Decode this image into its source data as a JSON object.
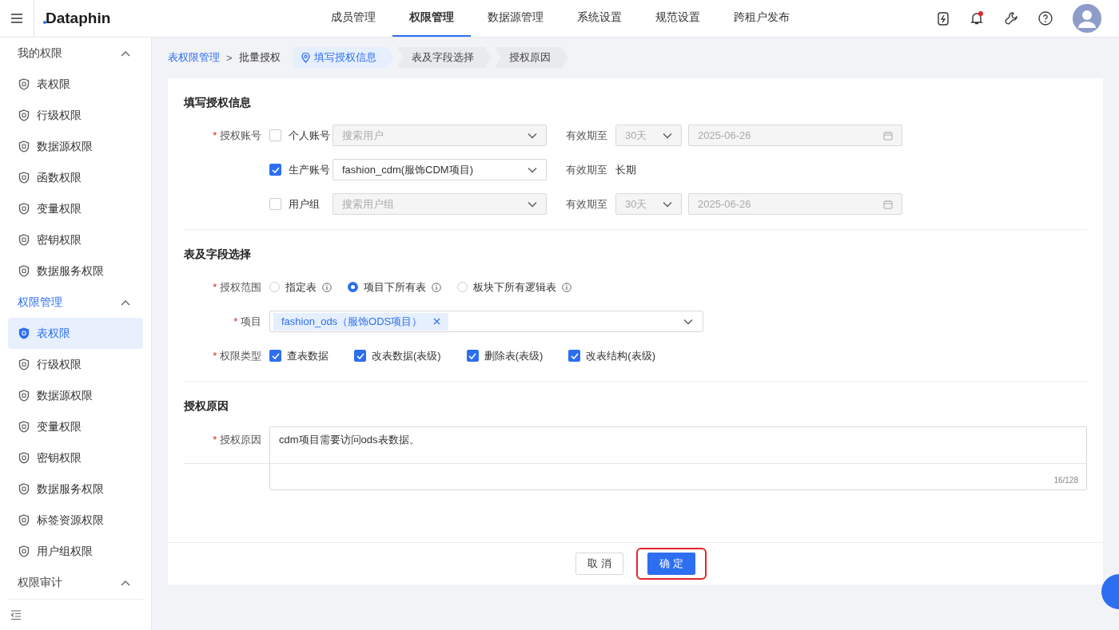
{
  "header": {
    "logo": "Dataphin",
    "nav": [
      {
        "label": "成员管理",
        "selected": false
      },
      {
        "label": "权限管理",
        "selected": true
      },
      {
        "label": "数据源管理",
        "selected": false
      },
      {
        "label": "系统设置",
        "selected": false
      },
      {
        "label": "规范设置",
        "selected": false
      },
      {
        "label": "跨租户发布",
        "selected": false
      }
    ],
    "unread_notifications": true
  },
  "sidebar": {
    "groups": [
      {
        "title": "我的权限",
        "selected": false,
        "expanded": true,
        "items": [
          {
            "label": "表权限",
            "selected": false
          },
          {
            "label": "行级权限",
            "selected": false
          },
          {
            "label": "数据源权限",
            "selected": false
          },
          {
            "label": "函数权限",
            "selected": false
          },
          {
            "label": "变量权限",
            "selected": false
          },
          {
            "label": "密钥权限",
            "selected": false
          },
          {
            "label": "数据服务权限",
            "selected": false
          }
        ]
      },
      {
        "title": "权限管理",
        "selected": true,
        "expanded": true,
        "items": [
          {
            "label": "表权限",
            "selected": true
          },
          {
            "label": "行级权限",
            "selected": false
          },
          {
            "label": "数据源权限",
            "selected": false
          },
          {
            "label": "变量权限",
            "selected": false
          },
          {
            "label": "密钥权限",
            "selected": false
          },
          {
            "label": "数据服务权限",
            "selected": false
          },
          {
            "label": "标签资源权限",
            "selected": false
          },
          {
            "label": "用户组权限",
            "selected": false
          }
        ]
      },
      {
        "title": "权限审计",
        "selected": false,
        "expanded": true
      }
    ]
  },
  "breadcrumb": [
    {
      "label": "表权限管理",
      "kind": "link"
    },
    {
      "separator": ">",
      "label": "批量授权",
      "kind": "text"
    }
  ],
  "steps": [
    {
      "label": "填写授权信息",
      "selected": true
    },
    {
      "label": "表及字段选择",
      "selected": false
    },
    {
      "label": "授权原因",
      "selected": false
    }
  ],
  "account_section": {
    "title": "填写授权信息",
    "required_mark": "*",
    "label": "授权账号",
    "rows": [
      {
        "label": "个人账号",
        "checked": false,
        "placeholder": "搜索用户",
        "expiry_label": "有效期至",
        "duration": "30天",
        "date": "2025-06-26"
      },
      {
        "label": "生产账号",
        "checked": true,
        "value": "fashion_cdm(服饰CDM项目)",
        "expiry_label": "有效期至",
        "expiry": "长期"
      },
      {
        "label": "用户组",
        "checked": false,
        "placeholder": "搜索用户组",
        "expiry_label": "有效期至",
        "duration": "30天",
        "date": "2025-06-26"
      }
    ]
  },
  "table_section": {
    "title": "表及字段选择",
    "scope": {
      "required_mark": "*",
      "label": "授权范围",
      "options": [
        {
          "label": "指定表",
          "selected": false
        },
        {
          "label": "项目下所有表",
          "selected": true
        },
        {
          "label": "板块下所有逻辑表",
          "selected": false
        }
      ]
    },
    "project": {
      "required_mark": "*",
      "label": "项目",
      "tags": [
        "fashion_ods（服饰ODS项目）"
      ]
    },
    "types": {
      "required_mark": "*",
      "label": "权限类型",
      "options": [
        {
          "label": "查表数据",
          "checked": true
        },
        {
          "label": "改表数据(表级)",
          "checked": true
        },
        {
          "label": "删除表(表级)",
          "checked": true
        },
        {
          "label": "改表结构(表级)",
          "checked": true
        }
      ]
    }
  },
  "reason_section": {
    "title": "授权原因",
    "required_mark": "*",
    "label": "授权原因",
    "value": "cdm项目需要访问ods表数据。",
    "counter": "16/128"
  },
  "buttons": [
    {
      "label": "取 消",
      "kind": "default",
      "highlighted": false
    },
    {
      "label": "确 定",
      "kind": "primary",
      "highlighted": true
    }
  ]
}
